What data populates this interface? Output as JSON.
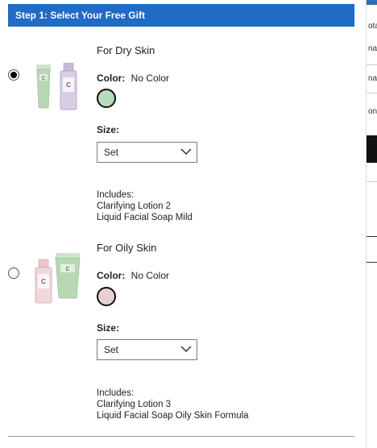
{
  "background": {
    "fragments": [
      "ota",
      "nat",
      "nat",
      "on"
    ]
  },
  "step": {
    "title": "Step 1: Select Your Free Gift"
  },
  "gifts": [
    {
      "title": "For Dry Skin",
      "selected": true,
      "color_label": "Color:",
      "color_value": "No Color",
      "swatch_color": "#b9dbb7",
      "size_label": "Size:",
      "size_value": "Set",
      "includes_label": "Includes:",
      "includes": [
        "Clarifying Lotion 2",
        "Liquid Facial Soap Mild"
      ]
    },
    {
      "title": "For Oily Skin",
      "selected": false,
      "color_label": "Color:",
      "color_value": "No Color",
      "swatch_color": "#e7cfd2",
      "size_label": "Size:",
      "size_value": "Set",
      "includes_label": "Includes:",
      "includes": [
        "Clarifying Lotion 3",
        "Liquid Facial Soap Oily Skin Formula"
      ]
    }
  ],
  "colors": {
    "header_bg": "#1f6bc6",
    "header_text": "#ffffff"
  }
}
